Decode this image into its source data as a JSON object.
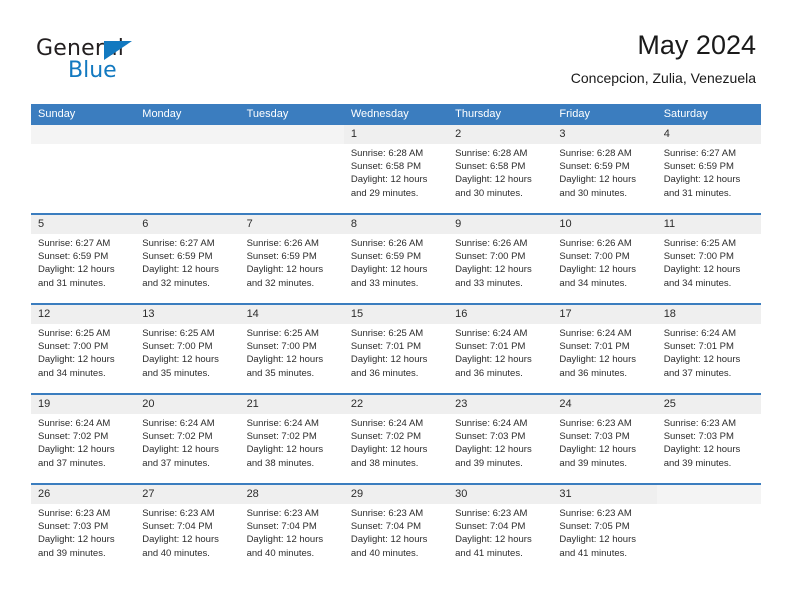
{
  "brand": {
    "name_part1": "General",
    "name_part2": "Blue",
    "triangle_color": "#1279c0"
  },
  "header": {
    "title": "May 2024",
    "subtitle": "Concepcion, Zulia, Venezuela"
  },
  "theme": {
    "accent": "#3b7dbf",
    "band": "#efefef",
    "text": "#2c2c2c"
  },
  "calendar": {
    "weekday_headers": [
      "Sunday",
      "Monday",
      "Tuesday",
      "Wednesday",
      "Thursday",
      "Friday",
      "Saturday"
    ],
    "weeks": [
      [
        {
          "day": "",
          "sunrise": "",
          "sunset": "",
          "daylight_line1": "",
          "daylight_line2": ""
        },
        {
          "day": "",
          "sunrise": "",
          "sunset": "",
          "daylight_line1": "",
          "daylight_line2": ""
        },
        {
          "day": "",
          "sunrise": "",
          "sunset": "",
          "daylight_line1": "",
          "daylight_line2": ""
        },
        {
          "day": "1",
          "sunrise": "Sunrise: 6:28 AM",
          "sunset": "Sunset: 6:58 PM",
          "daylight_line1": "Daylight: 12 hours",
          "daylight_line2": "and 29 minutes."
        },
        {
          "day": "2",
          "sunrise": "Sunrise: 6:28 AM",
          "sunset": "Sunset: 6:58 PM",
          "daylight_line1": "Daylight: 12 hours",
          "daylight_line2": "and 30 minutes."
        },
        {
          "day": "3",
          "sunrise": "Sunrise: 6:28 AM",
          "sunset": "Sunset: 6:59 PM",
          "daylight_line1": "Daylight: 12 hours",
          "daylight_line2": "and 30 minutes."
        },
        {
          "day": "4",
          "sunrise": "Sunrise: 6:27 AM",
          "sunset": "Sunset: 6:59 PM",
          "daylight_line1": "Daylight: 12 hours",
          "daylight_line2": "and 31 minutes."
        }
      ],
      [
        {
          "day": "5",
          "sunrise": "Sunrise: 6:27 AM",
          "sunset": "Sunset: 6:59 PM",
          "daylight_line1": "Daylight: 12 hours",
          "daylight_line2": "and 31 minutes."
        },
        {
          "day": "6",
          "sunrise": "Sunrise: 6:27 AM",
          "sunset": "Sunset: 6:59 PM",
          "daylight_line1": "Daylight: 12 hours",
          "daylight_line2": "and 32 minutes."
        },
        {
          "day": "7",
          "sunrise": "Sunrise: 6:26 AM",
          "sunset": "Sunset: 6:59 PM",
          "daylight_line1": "Daylight: 12 hours",
          "daylight_line2": "and 32 minutes."
        },
        {
          "day": "8",
          "sunrise": "Sunrise: 6:26 AM",
          "sunset": "Sunset: 6:59 PM",
          "daylight_line1": "Daylight: 12 hours",
          "daylight_line2": "and 33 minutes."
        },
        {
          "day": "9",
          "sunrise": "Sunrise: 6:26 AM",
          "sunset": "Sunset: 7:00 PM",
          "daylight_line1": "Daylight: 12 hours",
          "daylight_line2": "and 33 minutes."
        },
        {
          "day": "10",
          "sunrise": "Sunrise: 6:26 AM",
          "sunset": "Sunset: 7:00 PM",
          "daylight_line1": "Daylight: 12 hours",
          "daylight_line2": "and 34 minutes."
        },
        {
          "day": "11",
          "sunrise": "Sunrise: 6:25 AM",
          "sunset": "Sunset: 7:00 PM",
          "daylight_line1": "Daylight: 12 hours",
          "daylight_line2": "and 34 minutes."
        }
      ],
      [
        {
          "day": "12",
          "sunrise": "Sunrise: 6:25 AM",
          "sunset": "Sunset: 7:00 PM",
          "daylight_line1": "Daylight: 12 hours",
          "daylight_line2": "and 34 minutes."
        },
        {
          "day": "13",
          "sunrise": "Sunrise: 6:25 AM",
          "sunset": "Sunset: 7:00 PM",
          "daylight_line1": "Daylight: 12 hours",
          "daylight_line2": "and 35 minutes."
        },
        {
          "day": "14",
          "sunrise": "Sunrise: 6:25 AM",
          "sunset": "Sunset: 7:00 PM",
          "daylight_line1": "Daylight: 12 hours",
          "daylight_line2": "and 35 minutes."
        },
        {
          "day": "15",
          "sunrise": "Sunrise: 6:25 AM",
          "sunset": "Sunset: 7:01 PM",
          "daylight_line1": "Daylight: 12 hours",
          "daylight_line2": "and 36 minutes."
        },
        {
          "day": "16",
          "sunrise": "Sunrise: 6:24 AM",
          "sunset": "Sunset: 7:01 PM",
          "daylight_line1": "Daylight: 12 hours",
          "daylight_line2": "and 36 minutes."
        },
        {
          "day": "17",
          "sunrise": "Sunrise: 6:24 AM",
          "sunset": "Sunset: 7:01 PM",
          "daylight_line1": "Daylight: 12 hours",
          "daylight_line2": "and 36 minutes."
        },
        {
          "day": "18",
          "sunrise": "Sunrise: 6:24 AM",
          "sunset": "Sunset: 7:01 PM",
          "daylight_line1": "Daylight: 12 hours",
          "daylight_line2": "and 37 minutes."
        }
      ],
      [
        {
          "day": "19",
          "sunrise": "Sunrise: 6:24 AM",
          "sunset": "Sunset: 7:02 PM",
          "daylight_line1": "Daylight: 12 hours",
          "daylight_line2": "and 37 minutes."
        },
        {
          "day": "20",
          "sunrise": "Sunrise: 6:24 AM",
          "sunset": "Sunset: 7:02 PM",
          "daylight_line1": "Daylight: 12 hours",
          "daylight_line2": "and 37 minutes."
        },
        {
          "day": "21",
          "sunrise": "Sunrise: 6:24 AM",
          "sunset": "Sunset: 7:02 PM",
          "daylight_line1": "Daylight: 12 hours",
          "daylight_line2": "and 38 minutes."
        },
        {
          "day": "22",
          "sunrise": "Sunrise: 6:24 AM",
          "sunset": "Sunset: 7:02 PM",
          "daylight_line1": "Daylight: 12 hours",
          "daylight_line2": "and 38 minutes."
        },
        {
          "day": "23",
          "sunrise": "Sunrise: 6:24 AM",
          "sunset": "Sunset: 7:03 PM",
          "daylight_line1": "Daylight: 12 hours",
          "daylight_line2": "and 39 minutes."
        },
        {
          "day": "24",
          "sunrise": "Sunrise: 6:23 AM",
          "sunset": "Sunset: 7:03 PM",
          "daylight_line1": "Daylight: 12 hours",
          "daylight_line2": "and 39 minutes."
        },
        {
          "day": "25",
          "sunrise": "Sunrise: 6:23 AM",
          "sunset": "Sunset: 7:03 PM",
          "daylight_line1": "Daylight: 12 hours",
          "daylight_line2": "and 39 minutes."
        }
      ],
      [
        {
          "day": "26",
          "sunrise": "Sunrise: 6:23 AM",
          "sunset": "Sunset: 7:03 PM",
          "daylight_line1": "Daylight: 12 hours",
          "daylight_line2": "and 39 minutes."
        },
        {
          "day": "27",
          "sunrise": "Sunrise: 6:23 AM",
          "sunset": "Sunset: 7:04 PM",
          "daylight_line1": "Daylight: 12 hours",
          "daylight_line2": "and 40 minutes."
        },
        {
          "day": "28",
          "sunrise": "Sunrise: 6:23 AM",
          "sunset": "Sunset: 7:04 PM",
          "daylight_line1": "Daylight: 12 hours",
          "daylight_line2": "and 40 minutes."
        },
        {
          "day": "29",
          "sunrise": "Sunrise: 6:23 AM",
          "sunset": "Sunset: 7:04 PM",
          "daylight_line1": "Daylight: 12 hours",
          "daylight_line2": "and 40 minutes."
        },
        {
          "day": "30",
          "sunrise": "Sunrise: 6:23 AM",
          "sunset": "Sunset: 7:04 PM",
          "daylight_line1": "Daylight: 12 hours",
          "daylight_line2": "and 41 minutes."
        },
        {
          "day": "31",
          "sunrise": "Sunrise: 6:23 AM",
          "sunset": "Sunset: 7:05 PM",
          "daylight_line1": "Daylight: 12 hours",
          "daylight_line2": "and 41 minutes."
        },
        {
          "day": "",
          "sunrise": "",
          "sunset": "",
          "daylight_line1": "",
          "daylight_line2": ""
        }
      ]
    ]
  }
}
